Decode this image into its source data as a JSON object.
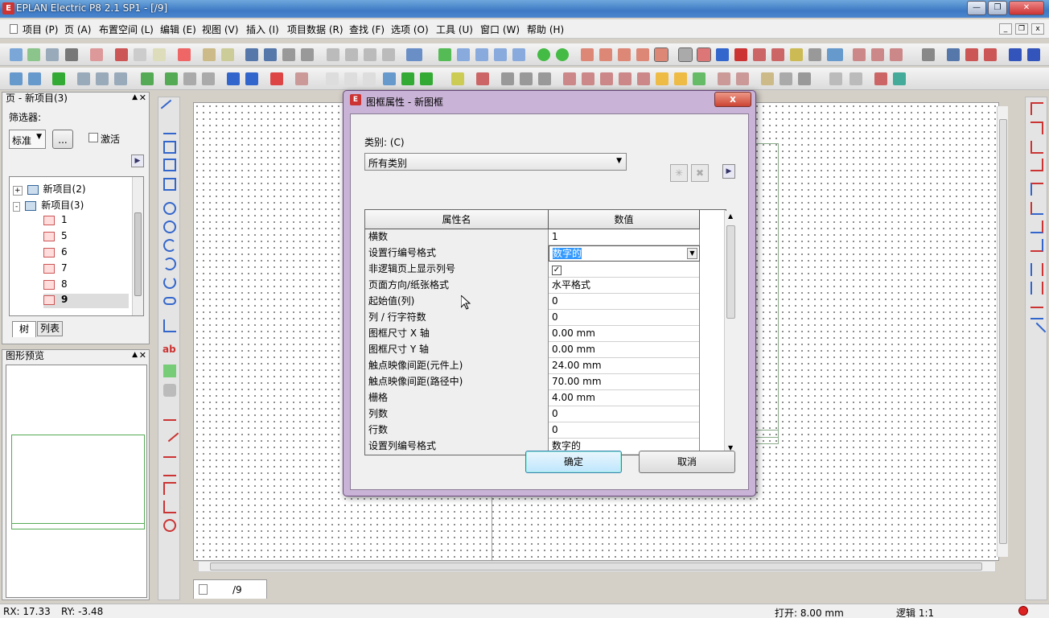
{
  "window": {
    "title": "EPLAN Electric P8 2.1 SP1 - [/9]",
    "app_icon": "eplan-icon"
  },
  "menu": [
    "项目 (P)",
    "页 (A)",
    "布置空间 (L)",
    "编辑 (E)",
    "视图 (V)",
    "插入 (I)",
    "项目数据 (R)",
    "查找 (F)",
    "选项 (O)",
    "工具 (U)",
    "窗口 (W)",
    "帮助 (H)"
  ],
  "page_panel": {
    "title": "页 - 新项目(3)",
    "filter_label": "筛选器:",
    "filter_value": "标准",
    "more_button": "...",
    "activate_label": "激活",
    "tree": {
      "nodes": [
        {
          "label": "新项目(2)",
          "expander": "+"
        },
        {
          "label": "新项目(3)",
          "expander": "-"
        }
      ],
      "pages": [
        "1",
        "5",
        "6",
        "7",
        "8",
        "9"
      ],
      "selected_page": "9"
    },
    "tabs": [
      "树",
      "列表"
    ]
  },
  "preview_panel": {
    "title": "图形预览"
  },
  "document_tab": {
    "label": "/9"
  },
  "dialog": {
    "title": "图框属性 - 新图框",
    "category_label": "类别: (C)",
    "category_value": "所有类别",
    "grid_headers": [
      "属性名",
      "数值"
    ],
    "rows": [
      {
        "name": "横数",
        "value": "1"
      },
      {
        "name": "设置行编号格式",
        "value": "数字的"
      },
      {
        "name": "非逻辑页上显示列号",
        "value": "✓"
      },
      {
        "name": "页面方向/纸张格式",
        "value": "水平格式"
      },
      {
        "name": "起始值(列)",
        "value": "0"
      },
      {
        "name": "列 / 行字符数",
        "value": "0"
      },
      {
        "name": "图框尺寸 X 轴",
        "value": "0.00 mm"
      },
      {
        "name": "图框尺寸 Y 轴",
        "value": "0.00 mm"
      },
      {
        "name": "触点映像间距(元件上)",
        "value": "24.00 mm"
      },
      {
        "name": "触点映像间距(路径中)",
        "value": "70.00 mm"
      },
      {
        "name": "栅格",
        "value": "4.00 mm"
      },
      {
        "name": "列数",
        "value": "0"
      },
      {
        "name": "行数",
        "value": "0"
      },
      {
        "name": "设置列编号格式",
        "value": "数字的"
      }
    ],
    "ok_label": "确定",
    "cancel_label": "取消",
    "close_label": "x"
  },
  "status": {
    "rx": "RX: 17.33",
    "ry": "RY: -3.48",
    "snap": "打开: 8.00 mm",
    "logic": "逻辑 1:1"
  },
  "colors": {
    "title_bar": "#3d79c4",
    "dialog_frame": "#c9b3d6",
    "selection": "#3399ff"
  }
}
